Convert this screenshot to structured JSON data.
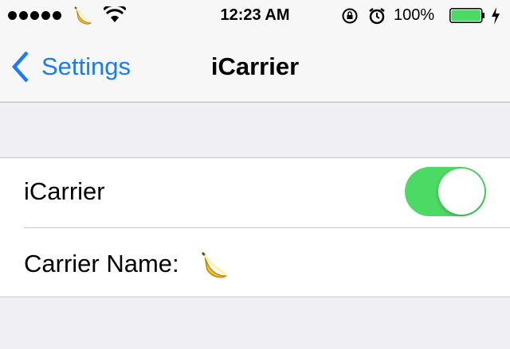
{
  "status_bar": {
    "time": "12:23 AM",
    "battery_percent": "100%",
    "battery_level": 1.0,
    "signal_bars": 5,
    "carrier_icon": "banana-icon"
  },
  "nav": {
    "back_label": "Settings",
    "title": "iCarrier"
  },
  "settings": {
    "toggle_label": "iCarrier",
    "toggle_on": true,
    "carrier_name_label": "Carrier Name:",
    "carrier_name_icon": "banana-icon"
  },
  "colors": {
    "accent": "#1a7cf4",
    "toggle_on": "#4cd964",
    "battery_fill": "#4cd964",
    "background": "#efeff4"
  }
}
